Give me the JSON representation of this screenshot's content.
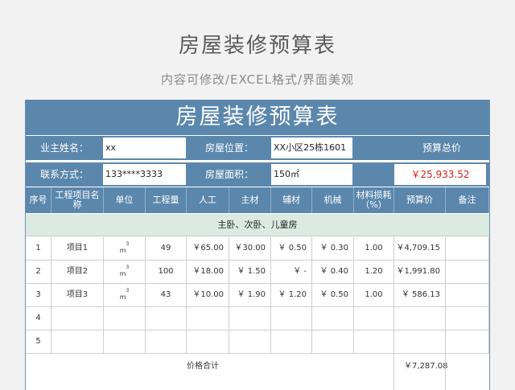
{
  "header": {
    "title": "房屋装修预算表",
    "subtitle": "内容可修改/EXCEL格式/界面美观"
  },
  "sheet": {
    "banner": "房屋装修预算表",
    "info": {
      "owner_label": "业主姓名：",
      "owner_value": "xx",
      "location_label": "房屋位置：",
      "location_value": "XX小区25栋1601",
      "budget_total_label": "预算总价",
      "contact_label": "联系方式：",
      "contact_value": "133****3333",
      "area_label": "房屋面积：",
      "area_value": "150㎡",
      "budget_total_value": "￥25,933.52"
    },
    "columns": [
      "序号",
      "工程项目名称",
      "单位",
      "工程量",
      "人工",
      "主材",
      "辅材",
      "机械",
      "材料损耗\n（%）",
      "预算价",
      "备注"
    ],
    "section_title": "主卧、次卧、儿童房",
    "rows": [
      {
        "no": "1",
        "name": "项目1",
        "unit": "m",
        "unit_sup": "3",
        "qty": "49",
        "labor": "￥65.00",
        "main": "￥30.00",
        "aux": "￥ 0.50",
        "mech": "￥ 0.30",
        "loss": "1.00",
        "price": "￥4,709.15",
        "note": ""
      },
      {
        "no": "2",
        "name": "项目2",
        "unit": "m",
        "unit_sup": "3",
        "qty": "100",
        "labor": "￥18.00",
        "main": "￥ 1.50",
        "aux": "￥  -",
        "mech": "￥ 0.40",
        "loss": "1.20",
        "price": "￥1,991.80",
        "note": ""
      },
      {
        "no": "3",
        "name": "项目3",
        "unit": "m",
        "unit_sup": "3",
        "qty": "43",
        "labor": "￥10.00",
        "main": "￥ 1.90",
        "aux": "￥ 1.20",
        "mech": "￥ 0.50",
        "loss": "1.00",
        "price": "￥   586.13",
        "note": ""
      },
      {
        "no": "4",
        "name": "",
        "unit": "",
        "unit_sup": "",
        "qty": "",
        "labor": "",
        "main": "",
        "aux": "",
        "mech": "",
        "loss": "",
        "price": "",
        "note": ""
      },
      {
        "no": "5",
        "name": "",
        "unit": "",
        "unit_sup": "",
        "qty": "",
        "labor": "",
        "main": "",
        "aux": "",
        "mech": "",
        "loss": "",
        "price": "",
        "note": ""
      }
    ],
    "subtotal_label": "价格合计",
    "subtotal_value": "￥7,287.08"
  },
  "colors": {
    "header_blue": "#5b87ad",
    "section_green": "#dcebe1",
    "total_red": "#e02020"
  }
}
